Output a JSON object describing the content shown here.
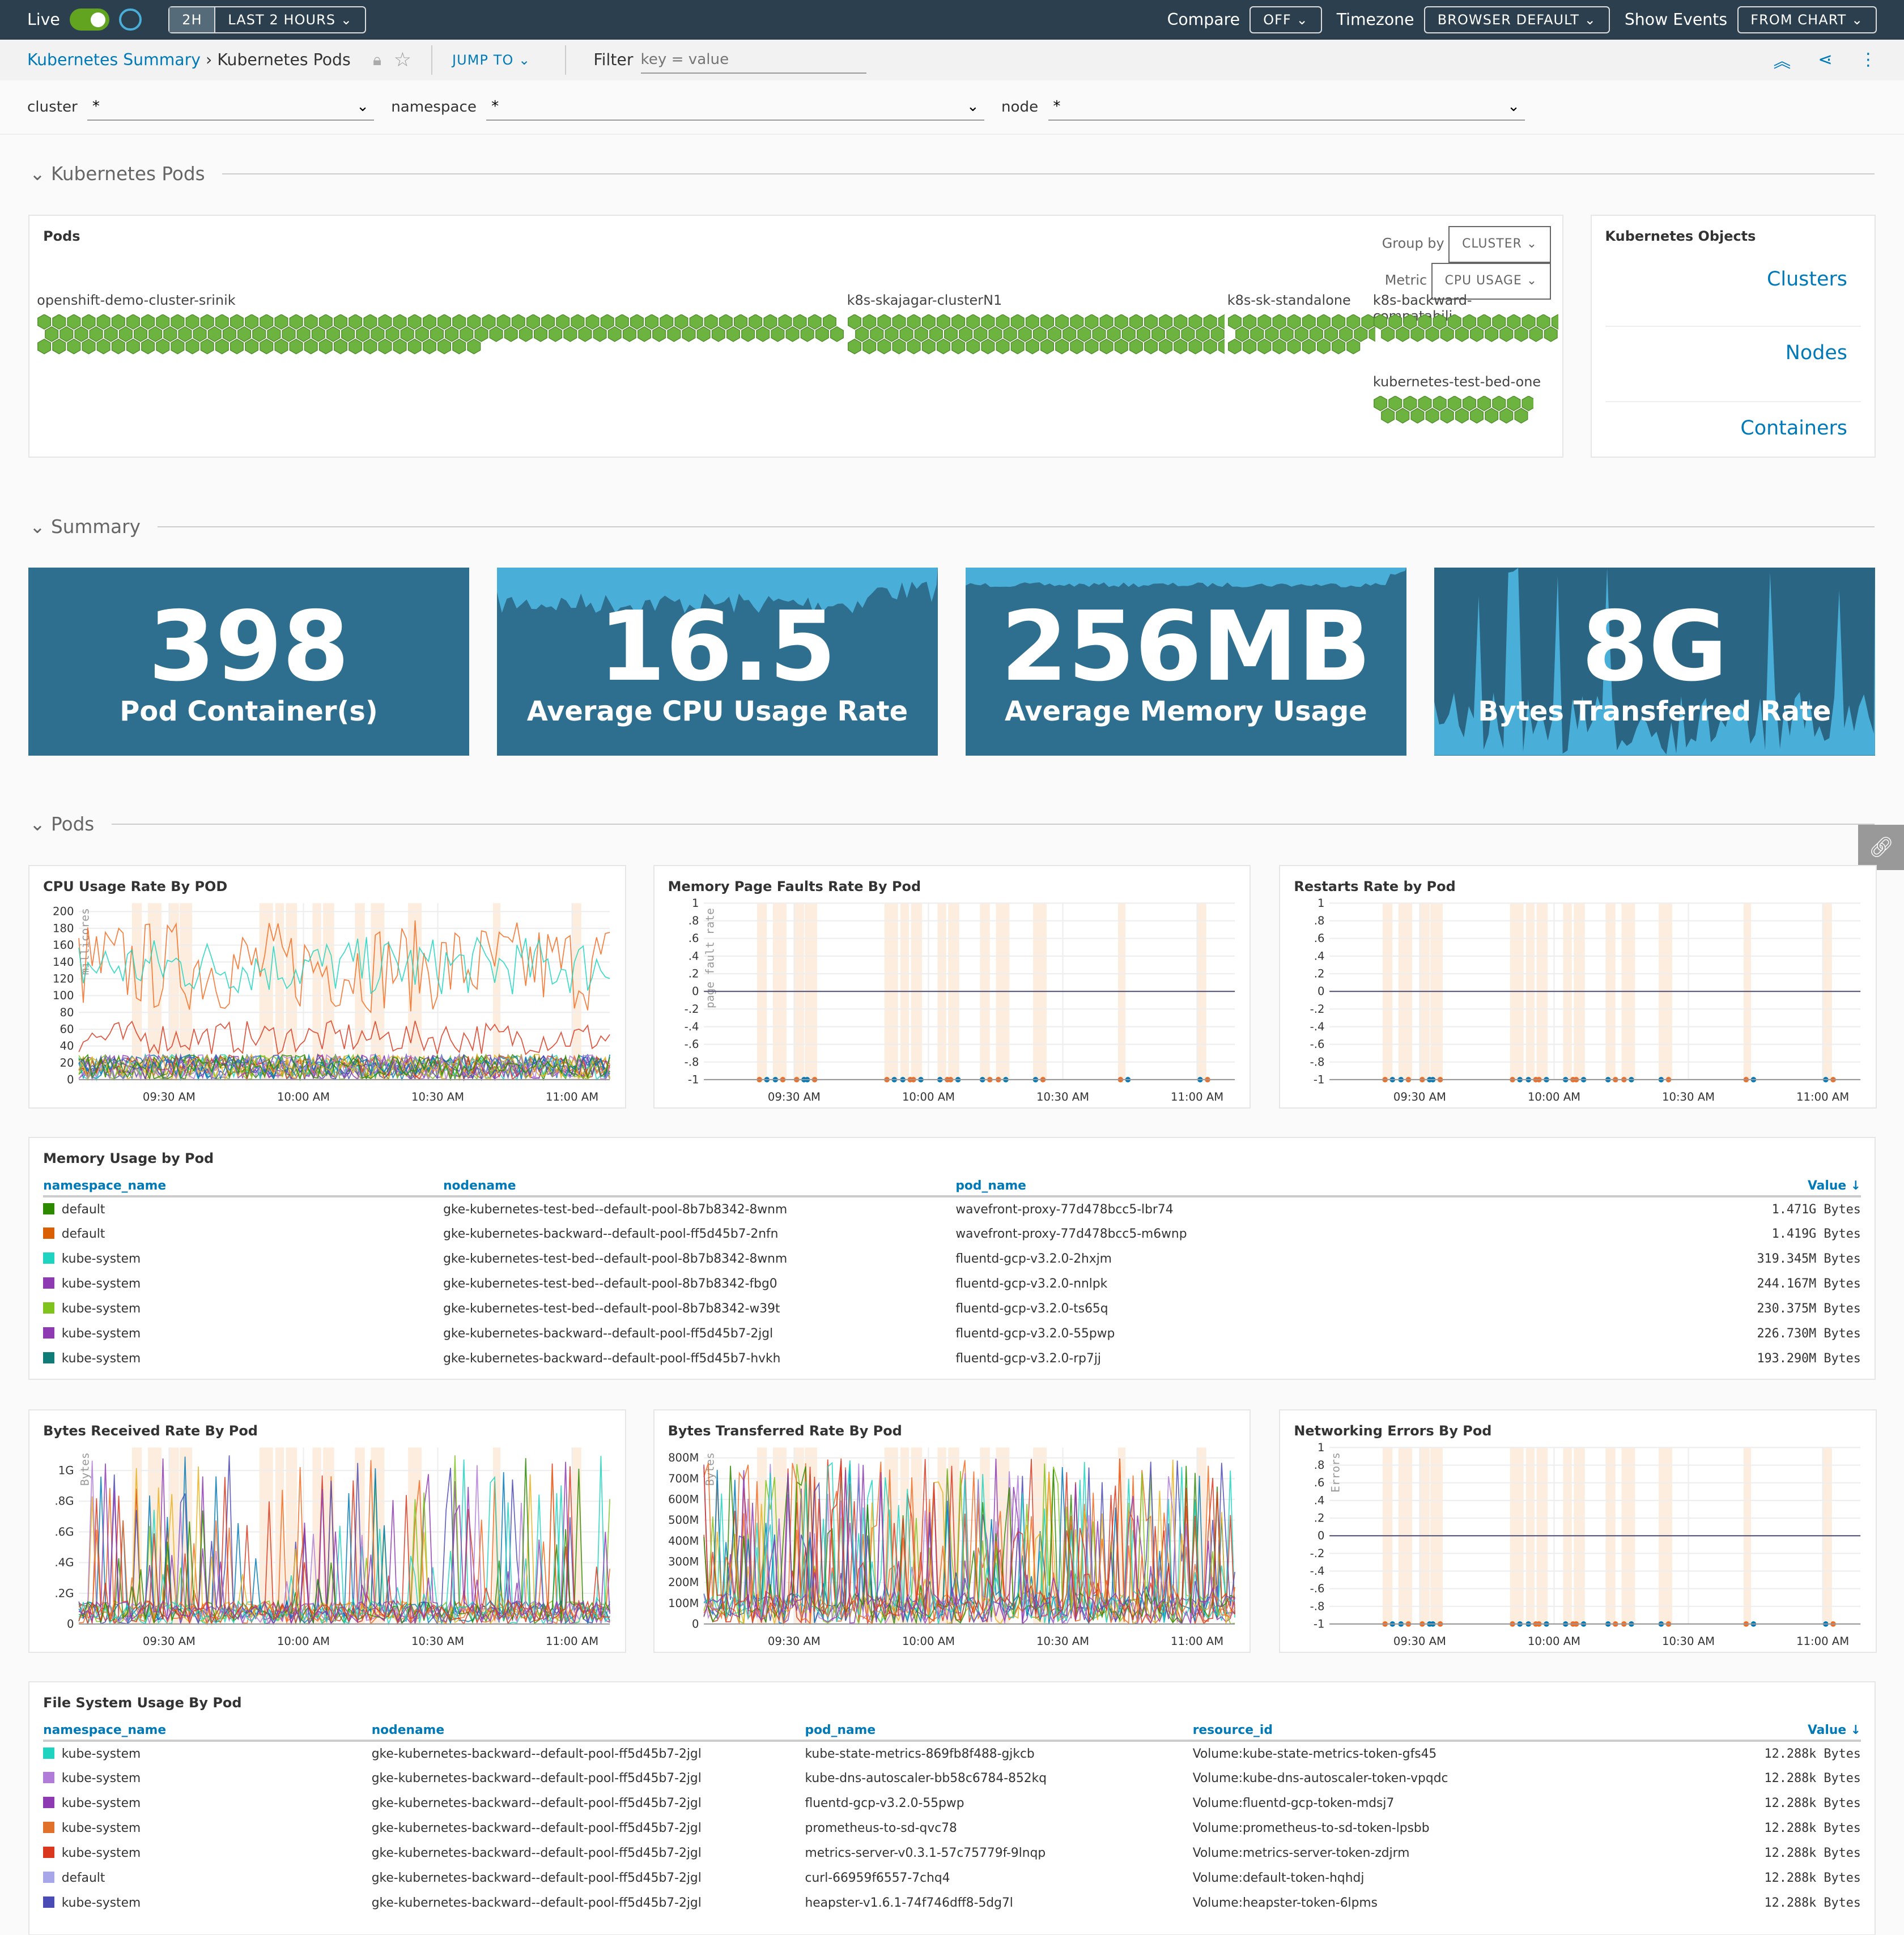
{
  "topbar": {
    "live": "Live",
    "range_short": "2H",
    "range": "LAST 2 HOURS",
    "compare": "Compare",
    "compare_val": "OFF",
    "timezone": "Timezone",
    "timezone_val": "BROWSER DEFAULT",
    "events": "Show Events",
    "events_val": "FROM CHART"
  },
  "crumbs": {
    "parent": "Kubernetes Summary",
    "current": "Kubernetes Pods",
    "jump": "JUMP TO",
    "filter": "Filter",
    "filter_placeholder": "key = value"
  },
  "filters": [
    {
      "label": "cluster",
      "value": "*"
    },
    {
      "label": "namespace",
      "value": "*"
    },
    {
      "label": "node",
      "value": "*"
    }
  ],
  "sections": {
    "pods_map": "Kubernetes Pods",
    "summary": "Summary",
    "pods": "Pods"
  },
  "pods_panel": {
    "title": "Pods",
    "group_by": "Group by",
    "group_val": "CLUSTER",
    "metric": "Metric",
    "metric_val": "CPU USAGE",
    "clusters": [
      "openshift-demo-cluster-srinik",
      "k8s-skajagar-clusterN1",
      "k8s-sk-standalone",
      "k8s-backward-compatabili...",
      "kubernetes-test-bed-one"
    ]
  },
  "objects": {
    "title": "Kubernetes Objects",
    "items": [
      "Clusters",
      "Nodes",
      "Containers"
    ]
  },
  "stats": [
    {
      "value": "398",
      "label": "Pod Container(s)"
    },
    {
      "value": "16.5",
      "label": "Average CPU Usage Rate"
    },
    {
      "value": "256MB",
      "label": "Average Memory Usage"
    },
    {
      "value": "8G",
      "label": "Bytes Transferred Rate"
    }
  ],
  "colors": {
    "accent": "#0079b8",
    "stat_bg": "#2e6e8e",
    "stat_spark": "#49afd9",
    "topbar": "#2b3f4e",
    "pod_hex": "#6db33f"
  },
  "chart_data": [
    {
      "type": "line",
      "title": "CPU Usage Rate By POD",
      "ylabel": "millicores",
      "yticks": [
        "0",
        "20",
        "40",
        "60",
        "80",
        "100",
        "120",
        "140",
        "160",
        "180",
        "200"
      ],
      "ylim": [
        0,
        210
      ],
      "xticks": [
        "09:30 AM",
        "10:00 AM",
        "10:30 AM",
        "11:00 AM"
      ]
    },
    {
      "type": "line",
      "title": "Memory Page Faults Rate By Pod",
      "ylabel": "page fault rate",
      "yticks": [
        "-1",
        "-.8",
        "-.6",
        "-.4",
        "-.2",
        "0",
        ".2",
        ".4",
        ".6",
        ".8",
        "1"
      ],
      "ylim": [
        -1,
        1
      ],
      "xticks": [
        "09:30 AM",
        "10:00 AM",
        "10:30 AM",
        "11:00 AM"
      ]
    },
    {
      "type": "line",
      "title": "Restarts Rate by Pod",
      "ylabel": "",
      "yticks": [
        "-1",
        "-.8",
        "-.6",
        "-.4",
        "-.2",
        "0",
        ".2",
        ".4",
        ".6",
        ".8",
        "1"
      ],
      "ylim": [
        -1,
        1
      ],
      "xticks": [
        "09:30 AM",
        "10:00 AM",
        "10:30 AM",
        "11:00 AM"
      ]
    },
    {
      "type": "line",
      "title": "Bytes Received Rate By Pod",
      "ylabel": "Bytes",
      "yticks": [
        "0",
        ".2G",
        ".4G",
        ".6G",
        ".8G",
        "1G"
      ],
      "ylim": [
        0,
        1.15
      ],
      "xticks": [
        "09:30 AM",
        "10:00 AM",
        "10:30 AM",
        "11:00 AM"
      ]
    },
    {
      "type": "line",
      "title": "Bytes Transferred Rate By Pod",
      "ylabel": "Bytes",
      "yticks": [
        "0",
        "100M",
        "200M",
        "300M",
        "400M",
        "500M",
        "600M",
        "700M",
        "800M"
      ],
      "ylim": [
        0,
        850
      ],
      "xticks": [
        "09:30 AM",
        "10:00 AM",
        "10:30 AM",
        "11:00 AM"
      ]
    },
    {
      "type": "line",
      "title": "Networking Errors By Pod",
      "ylabel": "Errors",
      "yticks": [
        "-1",
        "-.8",
        "-.6",
        "-.4",
        "-.2",
        "0",
        ".2",
        ".4",
        ".6",
        ".8",
        "1"
      ],
      "ylim": [
        -1,
        1
      ],
      "xticks": [
        "09:30 AM",
        "10:00 AM",
        "10:30 AM",
        "11:00 AM"
      ]
    }
  ],
  "memory_table": {
    "title": "Memory Usage by Pod",
    "headers": [
      "namespace_name",
      "nodename",
      "pod_name",
      "Value ↓"
    ],
    "rows": [
      [
        "#2d8a00",
        "default",
        "gke-kubernetes-test-bed--default-pool-8b7b8342-8wnm",
        "wavefront-proxy-77d478bcc5-lbr74",
        "1.471G Bytes"
      ],
      [
        "#d95f02",
        "default",
        "gke-kubernetes-backward--default-pool-ff5d45b7-2nfn",
        "wavefront-proxy-77d478bcc5-m6wnp",
        "1.419G Bytes"
      ],
      [
        "#1ed3c0",
        "kube-system",
        "gke-kubernetes-test-bed--default-pool-8b7b8342-8wnm",
        "fluentd-gcp-v3.2.0-2hxjm",
        "319.345M Bytes"
      ],
      [
        "#8e3bb3",
        "kube-system",
        "gke-kubernetes-test-bed--default-pool-8b7b8342-fbg0",
        "fluentd-gcp-v3.2.0-nnlpk",
        "244.167M Bytes"
      ],
      [
        "#80c31c",
        "kube-system",
        "gke-kubernetes-test-bed--default-pool-8b7b8342-w39t",
        "fluentd-gcp-v3.2.0-ts65q",
        "230.375M Bytes"
      ],
      [
        "#8e3bb3",
        "kube-system",
        "gke-kubernetes-backward--default-pool-ff5d45b7-2jgl",
        "fluentd-gcp-v3.2.0-55pwp",
        "226.730M Bytes"
      ],
      [
        "#0f7c78",
        "kube-system",
        "gke-kubernetes-backward--default-pool-ff5d45b7-hvkh",
        "fluentd-gcp-v3.2.0-rp7jj",
        "193.290M Bytes"
      ]
    ]
  },
  "fs_table": {
    "title": "File System Usage By Pod",
    "headers": [
      "namespace_name",
      "nodename",
      "pod_name",
      "resource_id",
      "Value ↓"
    ],
    "rows": [
      [
        "#1ed3c0",
        "kube-system",
        "gke-kubernetes-backward--default-pool-ff5d45b7-2jgl",
        "kube-state-metrics-869fb8f488-gjkcb",
        "Volume:kube-state-metrics-token-gfs45",
        "12.288k Bytes"
      ],
      [
        "#b07cd8",
        "kube-system",
        "gke-kubernetes-backward--default-pool-ff5d45b7-2jgl",
        "kube-dns-autoscaler-bb58c6784-852kq",
        "Volume:kube-dns-autoscaler-token-vpqdc",
        "12.288k Bytes"
      ],
      [
        "#8e3bb3",
        "kube-system",
        "gke-kubernetes-backward--default-pool-ff5d45b7-2jgl",
        "fluentd-gcp-v3.2.0-55pwp",
        "Volume:fluentd-gcp-token-mdsj7",
        "12.288k Bytes"
      ],
      [
        "#e0702a",
        "kube-system",
        "gke-kubernetes-backward--default-pool-ff5d45b7-2jgl",
        "prometheus-to-sd-qvc78",
        "Volume:prometheus-to-sd-token-lpsbb",
        "12.288k Bytes"
      ],
      [
        "#d9381e",
        "kube-system",
        "gke-kubernetes-backward--default-pool-ff5d45b7-2jgl",
        "metrics-server-v0.3.1-57c75779f-9lnqp",
        "Volume:metrics-server-token-zdjrm",
        "12.288k Bytes"
      ],
      [
        "#a6a6e8",
        "default",
        "gke-kubernetes-backward--default-pool-ff5d45b7-2jgl",
        "curl-66959f6557-7chq4",
        "Volume:default-token-hqhdj",
        "12.288k Bytes"
      ],
      [
        "#4b4bb5",
        "kube-system",
        "gke-kubernetes-backward--default-pool-ff5d45b7-2jgl",
        "heapster-v1.6.1-74f746dff8-5dg7l",
        "Volume:heapster-token-6lpms",
        "12.288k Bytes"
      ]
    ]
  }
}
